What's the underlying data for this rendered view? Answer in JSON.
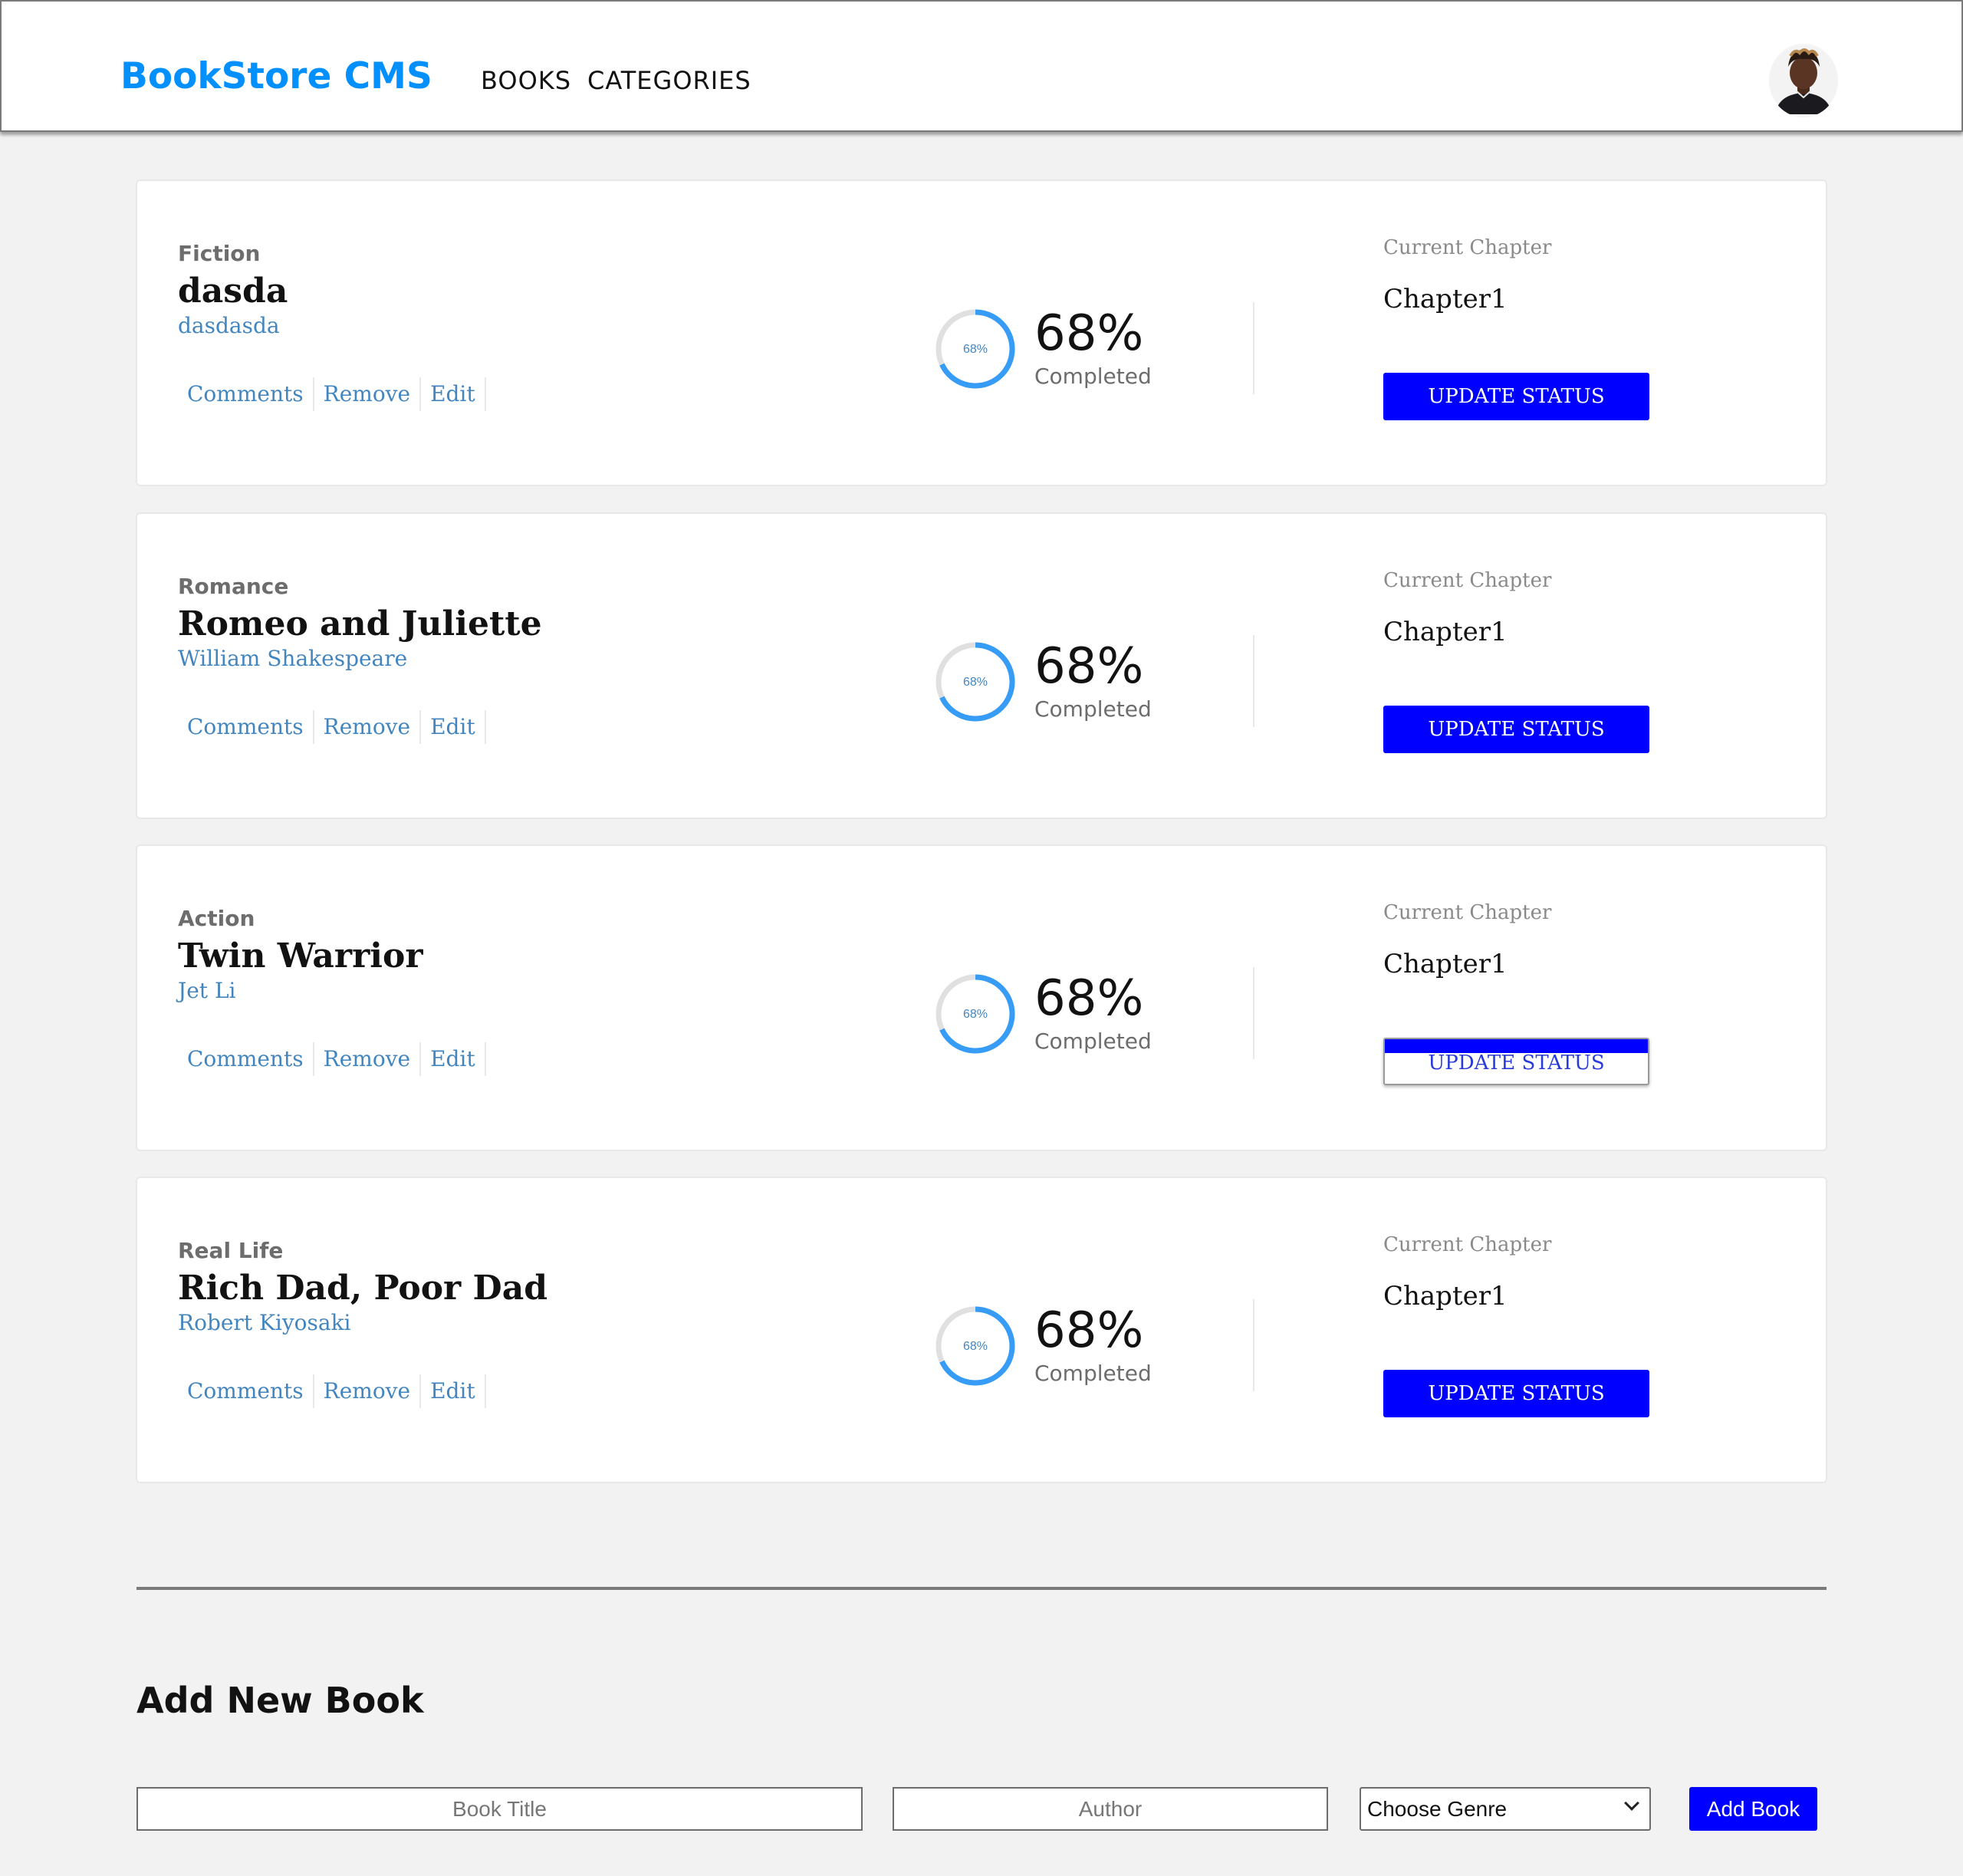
{
  "header": {
    "logo": "BookStore CMS",
    "nav": [
      {
        "label": "BOOKS"
      },
      {
        "label": "CATEGORIES"
      }
    ],
    "avatar_icon": "user-avatar-icon"
  },
  "books": [
    {
      "genre": "Fiction",
      "title": "dasda",
      "author": "dasdasda",
      "actions": [
        "Comments",
        "Remove",
        "Edit"
      ],
      "progress_ring_label": "68%",
      "progress_percent": "68%",
      "progress_value": 0.68,
      "progress_label": "Completed",
      "chapter_label": "Current Chapter",
      "chapter": "Chapter1",
      "button": "UPDATE STATUS"
    },
    {
      "genre": "Romance",
      "title": "Romeo and Juliette",
      "author": "William Shakespeare",
      "actions": [
        "Comments",
        "Remove",
        "Edit"
      ],
      "progress_ring_label": "68%",
      "progress_percent": "68%",
      "progress_value": 0.68,
      "progress_label": "Completed",
      "chapter_label": "Current Chapter",
      "chapter": "Chapter1",
      "button": "UPDATE STATUS"
    },
    {
      "genre": "Action",
      "title": "Twin Warrior",
      "author": "Jet Li",
      "actions": [
        "Comments",
        "Remove",
        "Edit"
      ],
      "progress_ring_label": "68%",
      "progress_percent": "68%",
      "progress_value": 0.68,
      "progress_label": "Completed",
      "chapter_label": "Current Chapter",
      "chapter": "Chapter1",
      "button": "UPDATE STATUS"
    },
    {
      "genre": "Real Life",
      "title": "Rich Dad, Poor Dad",
      "author": "Robert Kiyosaki",
      "actions": [
        "Comments",
        "Remove",
        "Edit"
      ],
      "progress_ring_label": "68%",
      "progress_percent": "68%",
      "progress_value": 0.68,
      "progress_label": "Completed",
      "chapter_label": "Current Chapter",
      "chapter": "Chapter1",
      "button": "UPDATE STATUS"
    }
  ],
  "add_form": {
    "heading": "Add New Book",
    "title_placeholder": "Book Title",
    "author_placeholder": "Author",
    "genre_selected": "Choose Genre",
    "submit_label": "Add Book"
  },
  "colors": {
    "brand": "#0290ff",
    "accent_button": "#0000ff",
    "link": "#4386bf",
    "progress_ring": "#379cf6",
    "background": "#f2f2f2"
  }
}
